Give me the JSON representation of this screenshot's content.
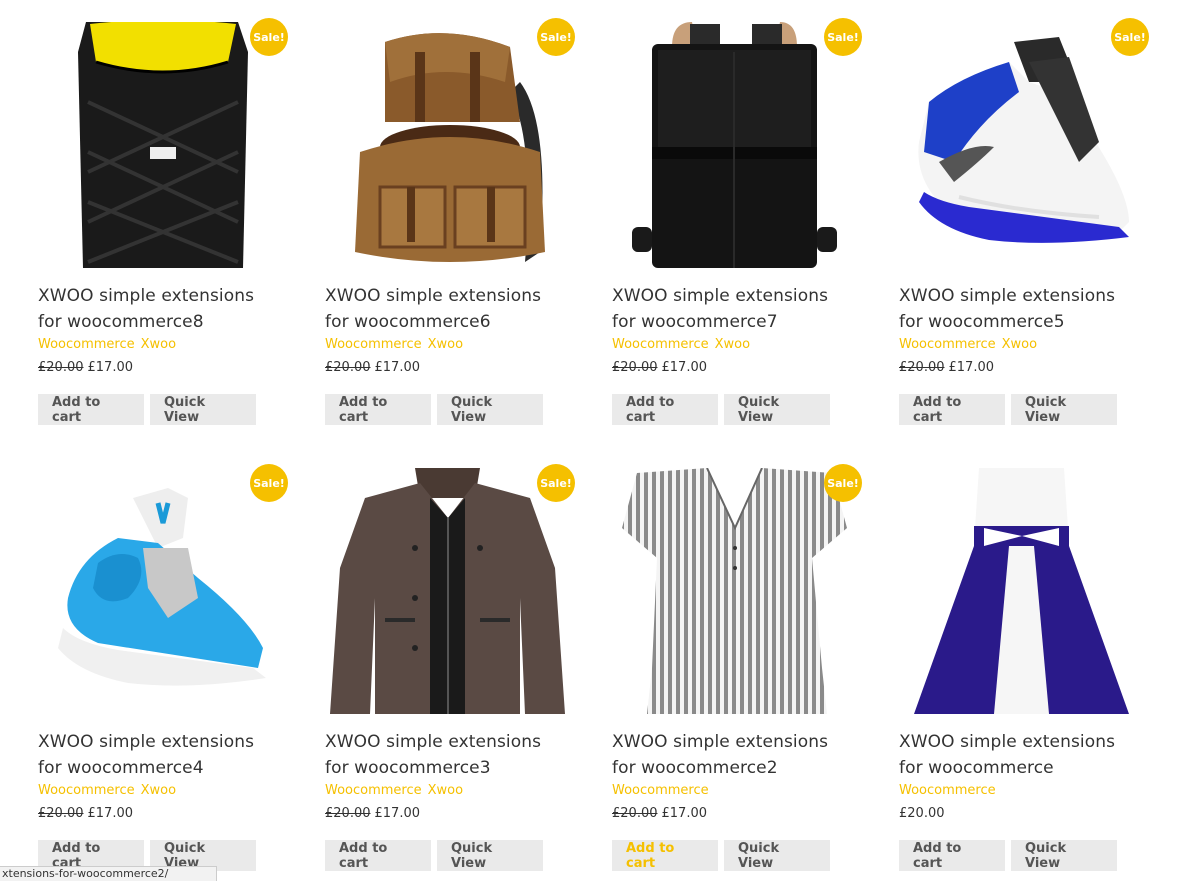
{
  "products": [
    {
      "title_line1": "XWOO simple extensions",
      "title_line2": "for woocommerce8",
      "categories": [
        "Woocommerce",
        "Xwoo"
      ],
      "old_price": "£20.00",
      "price": "£17.00",
      "sale_label": "Sale!",
      "add_label": "Add to cart",
      "quick_label": "Quick View",
      "image": "black-backpack-image"
    },
    {
      "title_line1": "XWOO simple extensions",
      "title_line2": "for woocommerce6",
      "categories": [
        "Woocommerce",
        "Xwoo"
      ],
      "old_price": "£20.00",
      "price": "£17.00",
      "sale_label": "Sale!",
      "add_label": "Add to cart",
      "quick_label": "Quick View",
      "image": "canvas-backpack-image"
    },
    {
      "title_line1": "XWOO simple extensions",
      "title_line2": "for woocommerce7",
      "categories": [
        "Woocommerce",
        "Xwoo"
      ],
      "old_price": "£20.00",
      "price": "£17.00",
      "sale_label": "Sale!",
      "add_label": "Add to cart",
      "quick_label": "Quick View",
      "image": "leather-backpack-image"
    },
    {
      "title_line1": "XWOO simple extensions",
      "title_line2": "for woocommerce5",
      "categories": [
        "Woocommerce",
        "Xwoo"
      ],
      "old_price": "£20.00",
      "price": "£17.00",
      "sale_label": "Sale!",
      "add_label": "Add to cart",
      "quick_label": "Quick View",
      "image": "blue-white-sneaker-image"
    },
    {
      "title_line1": "XWOO simple extensions",
      "title_line2": "for woocommerce4",
      "categories": [
        "Woocommerce",
        "Xwoo"
      ],
      "old_price": "£20.00",
      "price": "£17.00",
      "sale_label": "Sale!",
      "add_label": "Add to cart",
      "quick_label": "Quick View",
      "image": "light-blue-sneaker-image"
    },
    {
      "title_line1": "XWOO simple extensions",
      "title_line2": "for woocommerce3",
      "categories": [
        "Woocommerce",
        "Xwoo"
      ],
      "old_price": "£20.00",
      "price": "£17.00",
      "sale_label": "Sale!",
      "add_label": "Add to cart",
      "quick_label": "Quick View",
      "image": "brown-jacket-image"
    },
    {
      "title_line1": "XWOO simple extensions",
      "title_line2": "for woocommerce2",
      "categories": [
        "Woocommerce"
      ],
      "old_price": "£20.00",
      "price": "£17.00",
      "sale_label": "Sale!",
      "add_label": "Add to cart",
      "quick_label": "Quick View",
      "image": "striped-blouse-image"
    },
    {
      "title_line1": "XWOO simple extensions",
      "title_line2": "for woocommerce",
      "categories": [
        "Woocommerce"
      ],
      "old_price": "",
      "price": "£20.00",
      "sale_label": "",
      "add_label": "Add to cart",
      "quick_label": "Quick View",
      "image": "blue-dress-image"
    }
  ],
  "status_bar": "xtensions-for-woocommerce2/",
  "colors": {
    "accent": "#f5c000",
    "button_bg": "#eaeaea",
    "text": "#333333"
  }
}
